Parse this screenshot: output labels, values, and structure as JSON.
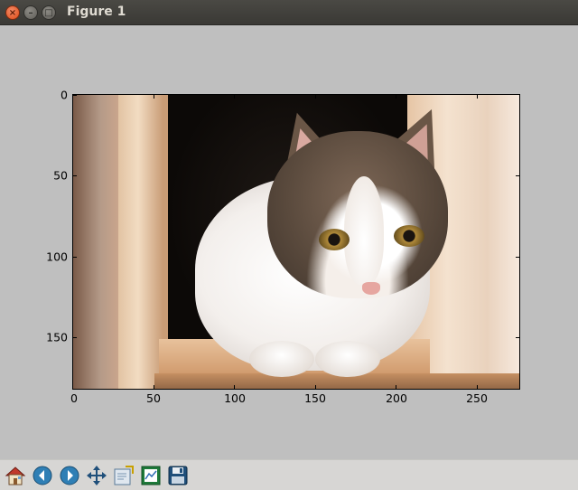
{
  "window": {
    "title": "Figure 1",
    "close_glyph": "×",
    "minimize_glyph": "–",
    "maximize_glyph": "□"
  },
  "axes": {
    "x_ticks": [
      "0",
      "50",
      "100",
      "150",
      "200",
      "250"
    ],
    "y_ticks": [
      "0",
      "50",
      "100",
      "150"
    ]
  },
  "image": {
    "description_icon": "cat-photo"
  },
  "toolbar": {
    "buttons": [
      {
        "icon": "home-icon"
      },
      {
        "icon": "back-arrow-icon"
      },
      {
        "icon": "forward-arrow-icon"
      },
      {
        "icon": "pan-move-icon"
      },
      {
        "icon": "zoom-to-rect-icon"
      },
      {
        "icon": "configure-subplots-icon"
      },
      {
        "icon": "save-icon"
      }
    ]
  },
  "colors": {
    "figure_bg": "#bfbfbf",
    "titlebar": "#3f3e3a",
    "close_button": "#df4b16",
    "toolbar_bg": "#d7d6d4"
  }
}
